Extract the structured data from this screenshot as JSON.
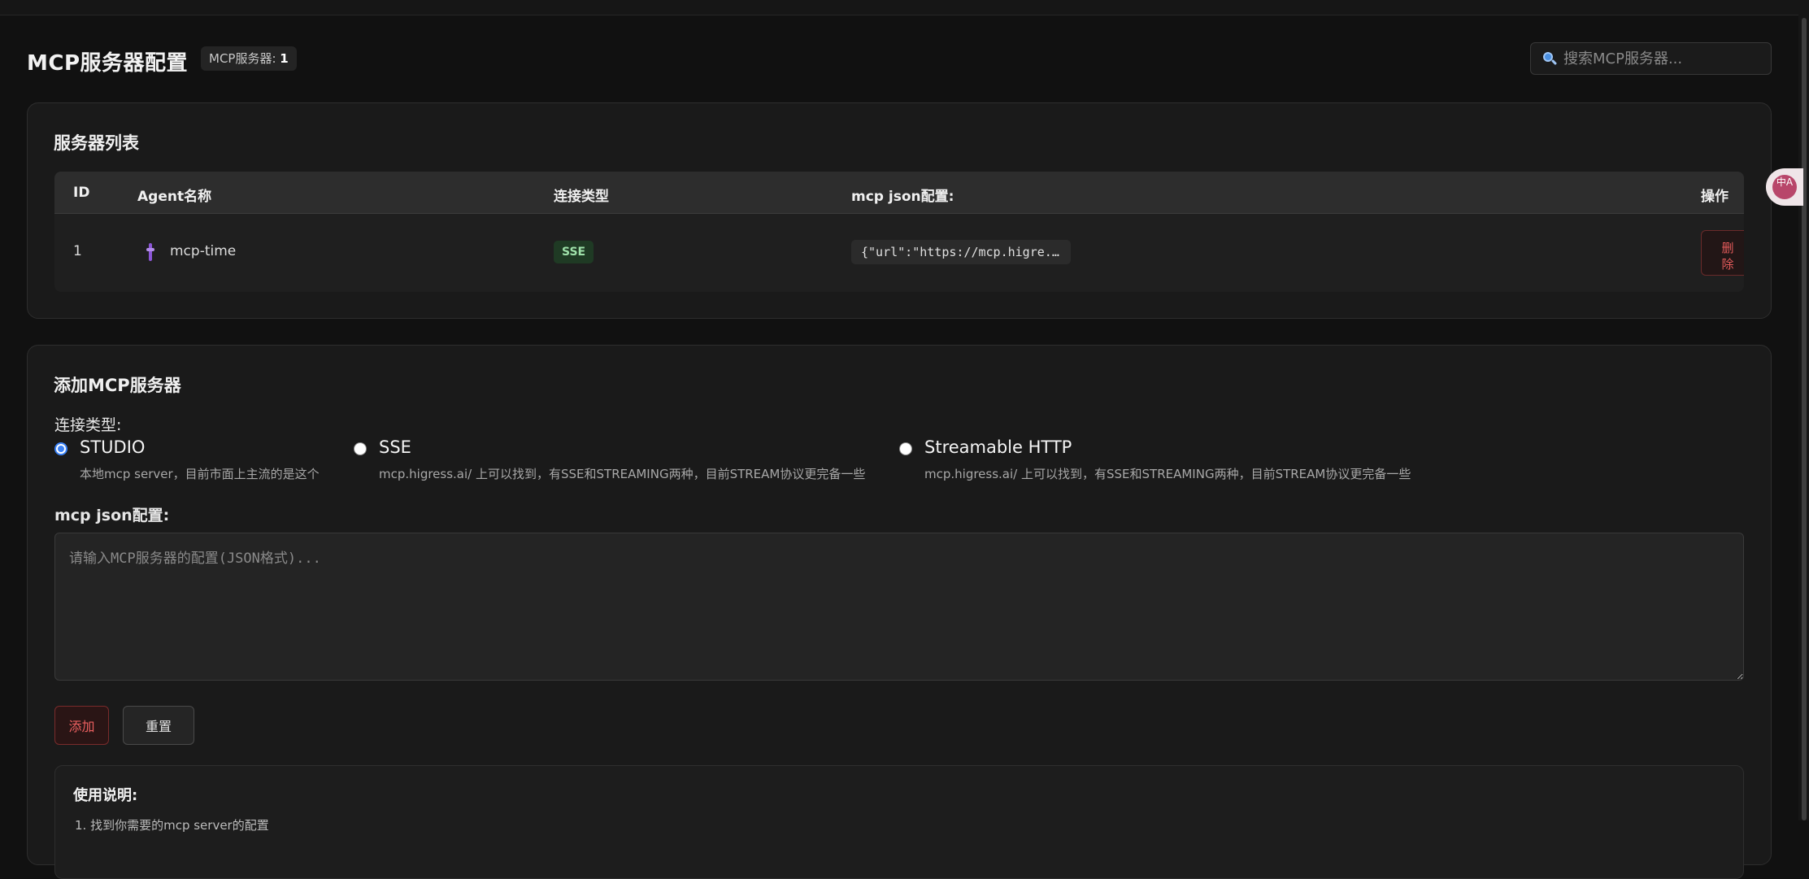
{
  "header": {
    "title": "MCP服务器配置",
    "count_label": "MCP服务器: ",
    "count_value": "1",
    "search_placeholder": "搜索MCP服务器..."
  },
  "server_list": {
    "title": "服务器列表",
    "columns": [
      "ID",
      "Agent名称",
      "连接类型",
      "mcp json配置:",
      "操作"
    ],
    "rows": [
      {
        "id": "1",
        "name": "mcp-time",
        "type": "SSE",
        "json": "{\"url\":\"https://mcp.higre...",
        "action_line1": "删",
        "action_line2": "除"
      }
    ]
  },
  "add_form": {
    "title": "添加MCP服务器",
    "type_label": "连接类型:",
    "options": [
      {
        "title": "STUDIO",
        "desc": "本地mcp server，目前市面上主流的是这个",
        "checked": true
      },
      {
        "title": "SSE",
        "desc": "mcp.higress.ai/ 上可以找到，有SSE和STREAMING两种，目前STREAM协议更完备一些",
        "checked": false
      },
      {
        "title": "Streamable HTTP",
        "desc": "mcp.higress.ai/ 上可以找到，有SSE和STREAMING两种，目前STREAM协议更完备一些",
        "checked": false
      }
    ],
    "json_label": "mcp json配置:",
    "json_placeholder": "请输入MCP服务器的配置(JSON格式)...",
    "add_label": "添加",
    "reset_label": "重置",
    "usage_title": "使用说明:",
    "usage_line": "1. 找到你需要的mcp server的配置"
  },
  "translate": {
    "label": "中A"
  },
  "colors": {
    "background": "#111111",
    "card": "#1a1a1a",
    "accent_red": "#e45b5b",
    "accent_blue": "#3b82f6",
    "tag_green": "#9ee0a9"
  },
  "icons": [
    "search-icon",
    "agent-icon",
    "translate-icon"
  ]
}
